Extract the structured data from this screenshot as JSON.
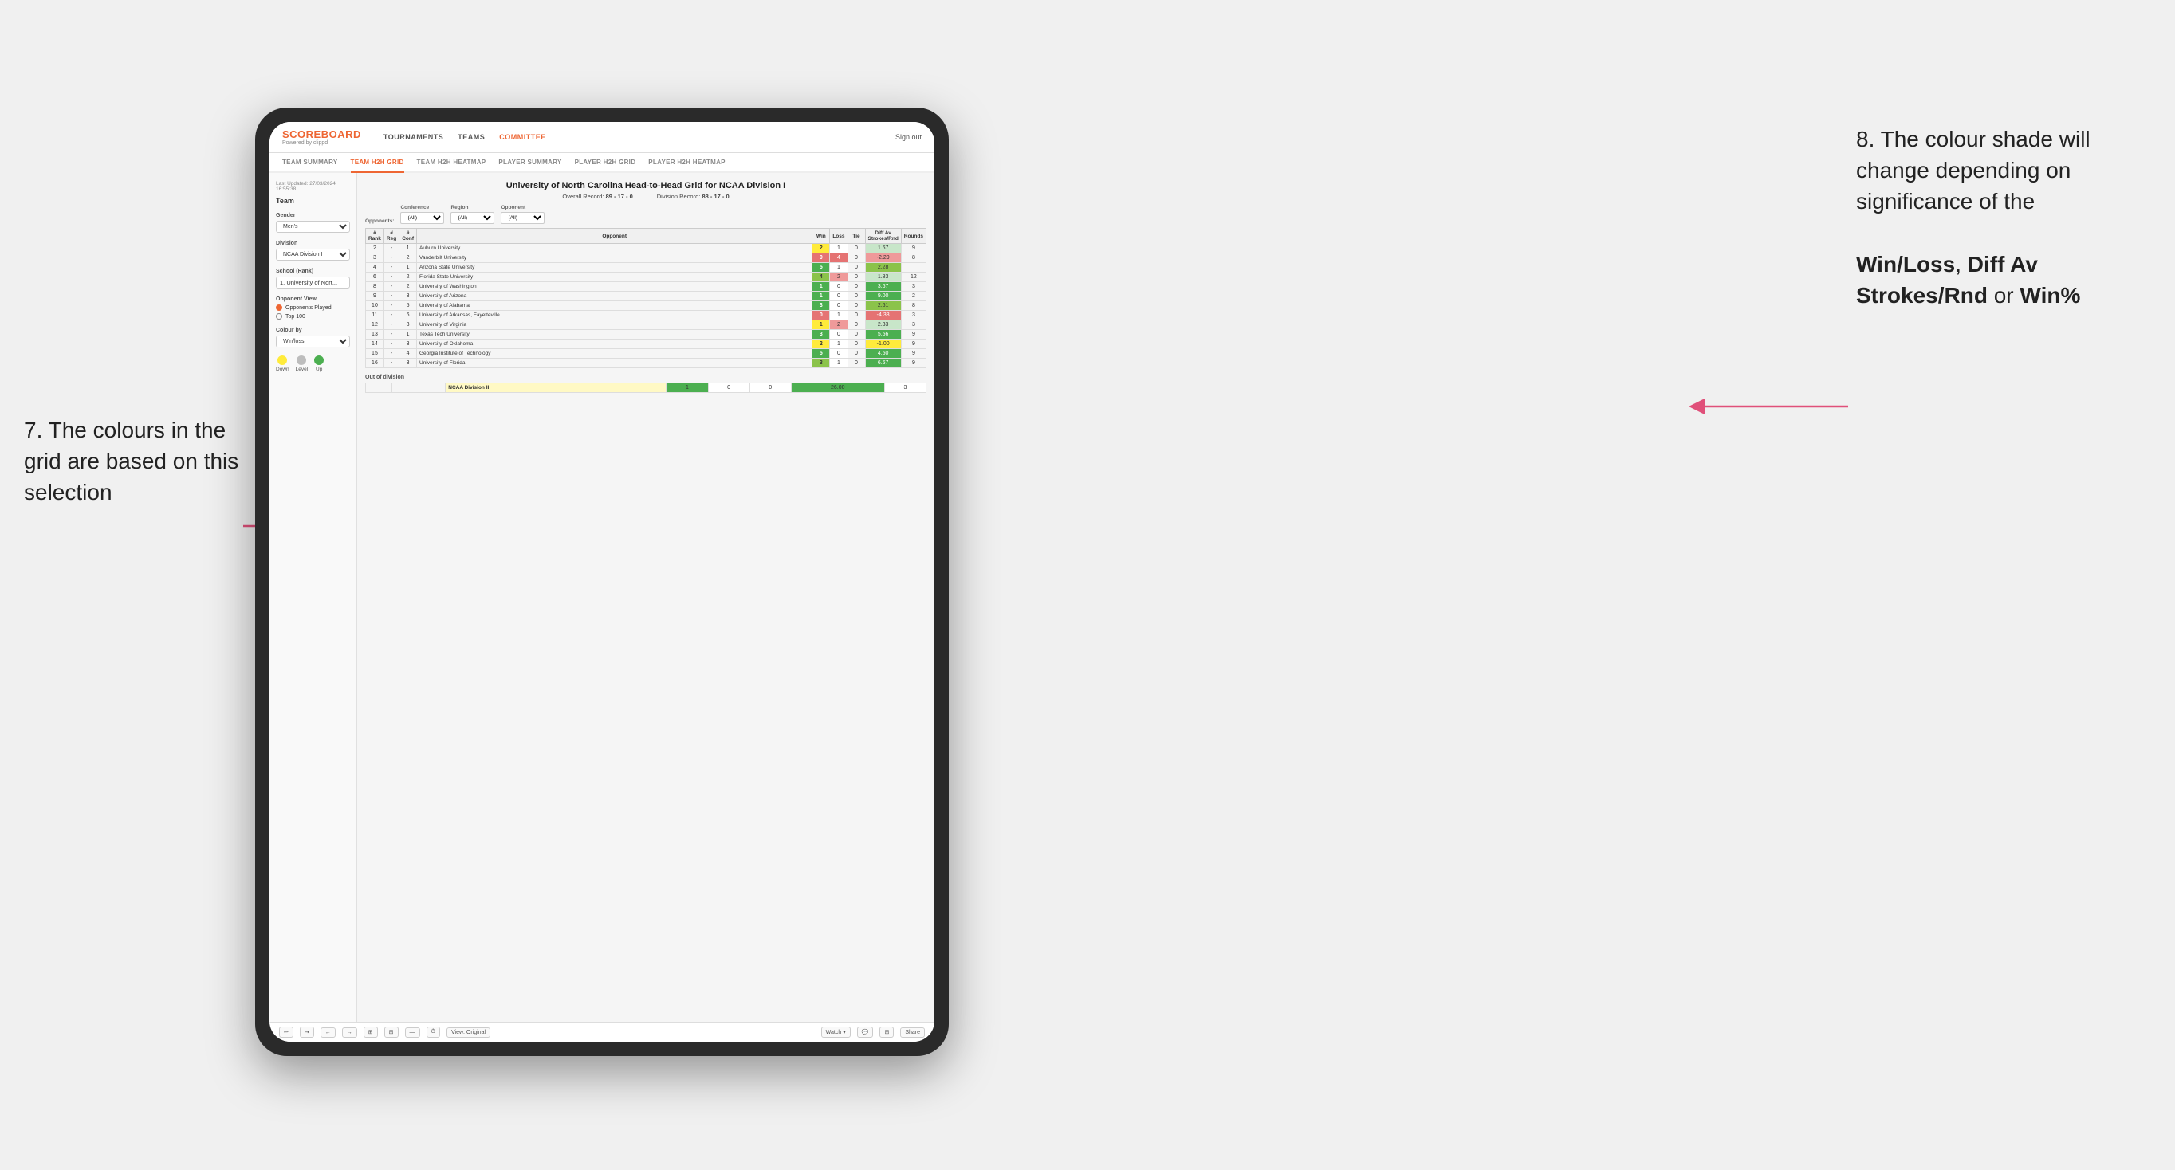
{
  "annotations": {
    "left_text": "7. The colours in the grid are based on this selection",
    "right_title": "8. The colour shade will change depending on significance of the",
    "right_bold1": "Win/Loss",
    "right_bold2": "Diff Av Strokes/Rnd",
    "right_bold3": "Win%"
  },
  "nav": {
    "logo": "SCOREBOARD",
    "logo_sub": "Powered by clippd",
    "items": [
      "TOURNAMENTS",
      "TEAMS",
      "COMMITTEE"
    ],
    "sign_out": "Sign out"
  },
  "sub_tabs": [
    "TEAM SUMMARY",
    "TEAM H2H GRID",
    "TEAM H2H HEATMAP",
    "PLAYER SUMMARY",
    "PLAYER H2H GRID",
    "PLAYER H2H HEATMAP"
  ],
  "active_sub_tab": "TEAM H2H GRID",
  "sidebar": {
    "timestamp": "Last Updated: 27/03/2024\n16:55:38",
    "team_label": "Team",
    "gender_label": "Gender",
    "gender_value": "Men's",
    "division_label": "Division",
    "division_value": "NCAA Division I",
    "school_label": "School (Rank)",
    "school_value": "1. University of Nort...",
    "opponent_view_label": "Opponent View",
    "opponent_options": [
      "Opponents Played",
      "Top 100"
    ],
    "opponent_selected": "Opponents Played",
    "colour_by_label": "Colour by",
    "colour_by_value": "Win/loss",
    "legend": {
      "down": "Down",
      "level": "Level",
      "up": "Up"
    }
  },
  "grid": {
    "title": "University of North Carolina Head-to-Head Grid for NCAA Division I",
    "overall_record": "89 - 17 - 0",
    "division_record": "88 - 17 - 0",
    "filters": {
      "opponents_label": "Opponents:",
      "conference_label": "Conference",
      "conference_value": "(All)",
      "region_label": "Region",
      "region_value": "(All)",
      "opponent_label": "Opponent",
      "opponent_value": "(All)"
    },
    "columns": [
      "#\nRank",
      "#\nReg",
      "#\nConf",
      "Opponent",
      "Win",
      "Loss",
      "Tie",
      "Diff Av\nStrokes/Rnd",
      "Rounds"
    ],
    "rows": [
      {
        "rank": "2",
        "reg": "-",
        "conf": "1",
        "opponent": "Auburn University",
        "win": "2",
        "loss": "1",
        "tie": "0",
        "diff": "1.67",
        "rounds": "9",
        "win_color": "yellow",
        "diff_color": "green-light"
      },
      {
        "rank": "3",
        "reg": "-",
        "conf": "2",
        "opponent": "Vanderbilt University",
        "win": "0",
        "loss": "4",
        "tie": "0",
        "diff": "-2.29",
        "rounds": "8",
        "win_color": "red-med",
        "diff_color": "red-light"
      },
      {
        "rank": "4",
        "reg": "-",
        "conf": "1",
        "opponent": "Arizona State University",
        "win": "5",
        "loss": "1",
        "tie": "0",
        "diff": "2.28",
        "rounds": "",
        "win_color": "green-dark",
        "diff_color": "green-med"
      },
      {
        "rank": "6",
        "reg": "-",
        "conf": "2",
        "opponent": "Florida State University",
        "win": "4",
        "loss": "2",
        "tie": "0",
        "diff": "1.83",
        "rounds": "12",
        "win_color": "green-med",
        "diff_color": "green-light"
      },
      {
        "rank": "8",
        "reg": "-",
        "conf": "2",
        "opponent": "University of Washington",
        "win": "1",
        "loss": "0",
        "tie": "0",
        "diff": "3.67",
        "rounds": "3",
        "win_color": "green-dark",
        "diff_color": "green-dark"
      },
      {
        "rank": "9",
        "reg": "-",
        "conf": "3",
        "opponent": "University of Arizona",
        "win": "1",
        "loss": "0",
        "tie": "0",
        "diff": "9.00",
        "rounds": "2",
        "win_color": "green-dark",
        "diff_color": "green-dark"
      },
      {
        "rank": "10",
        "reg": "-",
        "conf": "5",
        "opponent": "University of Alabama",
        "win": "3",
        "loss": "0",
        "tie": "0",
        "diff": "2.61",
        "rounds": "8",
        "win_color": "green-dark",
        "diff_color": "green-med"
      },
      {
        "rank": "11",
        "reg": "-",
        "conf": "6",
        "opponent": "University of Arkansas, Fayetteville",
        "win": "0",
        "loss": "1",
        "tie": "0",
        "diff": "-4.33",
        "rounds": "3",
        "win_color": "red-med",
        "diff_color": "red-med"
      },
      {
        "rank": "12",
        "reg": "-",
        "conf": "3",
        "opponent": "University of Virginia",
        "win": "1",
        "loss": "2",
        "tie": "0",
        "diff": "2.33",
        "rounds": "3",
        "win_color": "yellow",
        "diff_color": "green-light"
      },
      {
        "rank": "13",
        "reg": "-",
        "conf": "1",
        "opponent": "Texas Tech University",
        "win": "3",
        "loss": "0",
        "tie": "0",
        "diff": "5.56",
        "rounds": "9",
        "win_color": "green-dark",
        "diff_color": "green-dark"
      },
      {
        "rank": "14",
        "reg": "-",
        "conf": "3",
        "opponent": "University of Oklahoma",
        "win": "2",
        "loss": "1",
        "tie": "0",
        "diff": "-1.00",
        "rounds": "9",
        "win_color": "yellow",
        "diff_color": "yellow"
      },
      {
        "rank": "15",
        "reg": "-",
        "conf": "4",
        "opponent": "Georgia Institute of Technology",
        "win": "5",
        "loss": "0",
        "tie": "0",
        "diff": "4.50",
        "rounds": "9",
        "win_color": "green-dark",
        "diff_color": "green-dark"
      },
      {
        "rank": "16",
        "reg": "-",
        "conf": "3",
        "opponent": "University of Florida",
        "win": "3",
        "loss": "1",
        "tie": "0",
        "diff": "6.67",
        "rounds": "9",
        "win_color": "green-med",
        "diff_color": "green-dark"
      }
    ],
    "out_division_label": "Out of division",
    "out_division_row": {
      "name": "NCAA Division II",
      "win": "1",
      "loss": "0",
      "tie": "0",
      "diff": "26.00",
      "rounds": "3",
      "win_color": "green-dark",
      "diff_color": "green-dark"
    }
  },
  "toolbar": {
    "view_label": "View: Original",
    "watch_label": "Watch ▾",
    "share_label": "Share"
  }
}
